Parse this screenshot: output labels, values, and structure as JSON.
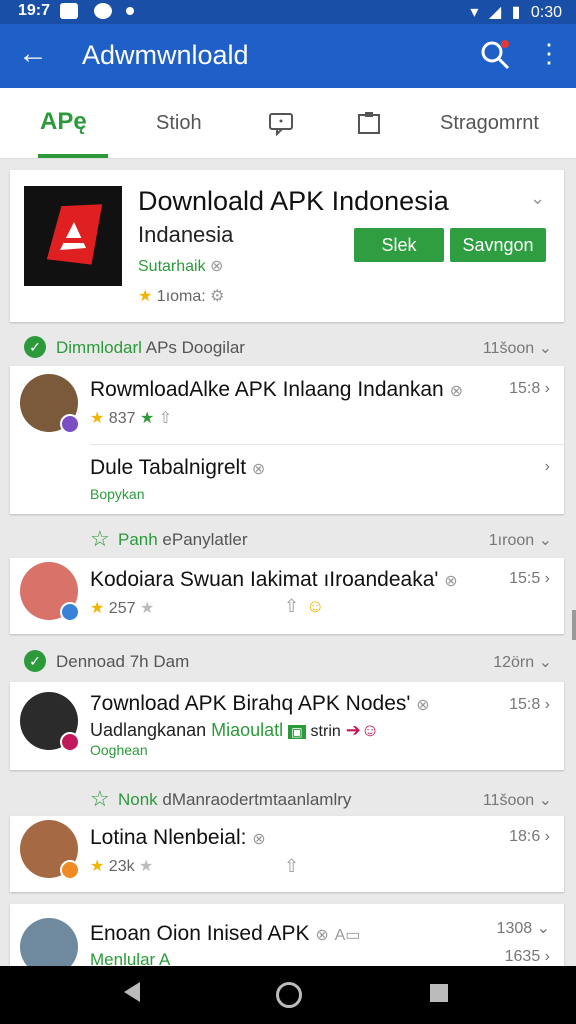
{
  "status": {
    "time": "19:7",
    "battery_time": "0:30"
  },
  "appbar": {
    "title": "Adwmwnloald"
  },
  "tabs": [
    {
      "label": "APę"
    },
    {
      "label": "Stioh"
    },
    {
      "label": "Stragomrnt"
    }
  ],
  "hero": {
    "title": "Downloald APK Indonesia",
    "subtitle": "Indanesia",
    "developer": "Sutarhaik",
    "rating": "1ıoma:",
    "btn1": "Slek",
    "btn2": "Savngon"
  },
  "sections": [
    {
      "label_green": "Dimmlodarl",
      "label_gray": " APs Doogilar",
      "meta": "11šoon ⌄"
    },
    {
      "label_green": "Panh",
      "label_gray": " ePanylatler",
      "meta": "1ıroon ⌄"
    },
    {
      "label_green": "",
      "label_gray": "Dennoad 7h Dam",
      "meta": "12örn ⌄"
    },
    {
      "label_green": "Nonk",
      "label_gray": " dManraodertmtaanlamlry",
      "meta": "11šoon ⌄"
    }
  ],
  "rows": [
    {
      "title": "RowmloadAlke APK Inlaang Indankan",
      "line2": "837",
      "line3": "",
      "time": "15:8 ›"
    },
    {
      "title": "Dule Tabalnigrelt",
      "line2": "",
      "line3": "Bopykan",
      "time": "›"
    },
    {
      "title": "Kodoiara Swuan Iakimat ıIroandeaka'",
      "line2": "257",
      "line3": "",
      "time": "15:5 ›"
    },
    {
      "title": "7ownload APK Birahq APK Nodes'",
      "line2": "Uadlangkanan",
      "line2_green": "Miaoulatl",
      "line2_tail": "strin",
      "line3": "Ooghean",
      "time": "15:8 ›"
    },
    {
      "title": "Lotina Nlenbeial:",
      "line2": "23k",
      "line3": "",
      "time": "18:6 ›"
    },
    {
      "title": "Enoan Oion Inised APK",
      "line2": "Menlular A",
      "line3": "",
      "time": "1308 ⌄",
      "time2": "1635 ›"
    }
  ],
  "colors": {
    "primary": "#1e5fc8",
    "green": "#2c9a3a",
    "star": "#f3b400"
  }
}
